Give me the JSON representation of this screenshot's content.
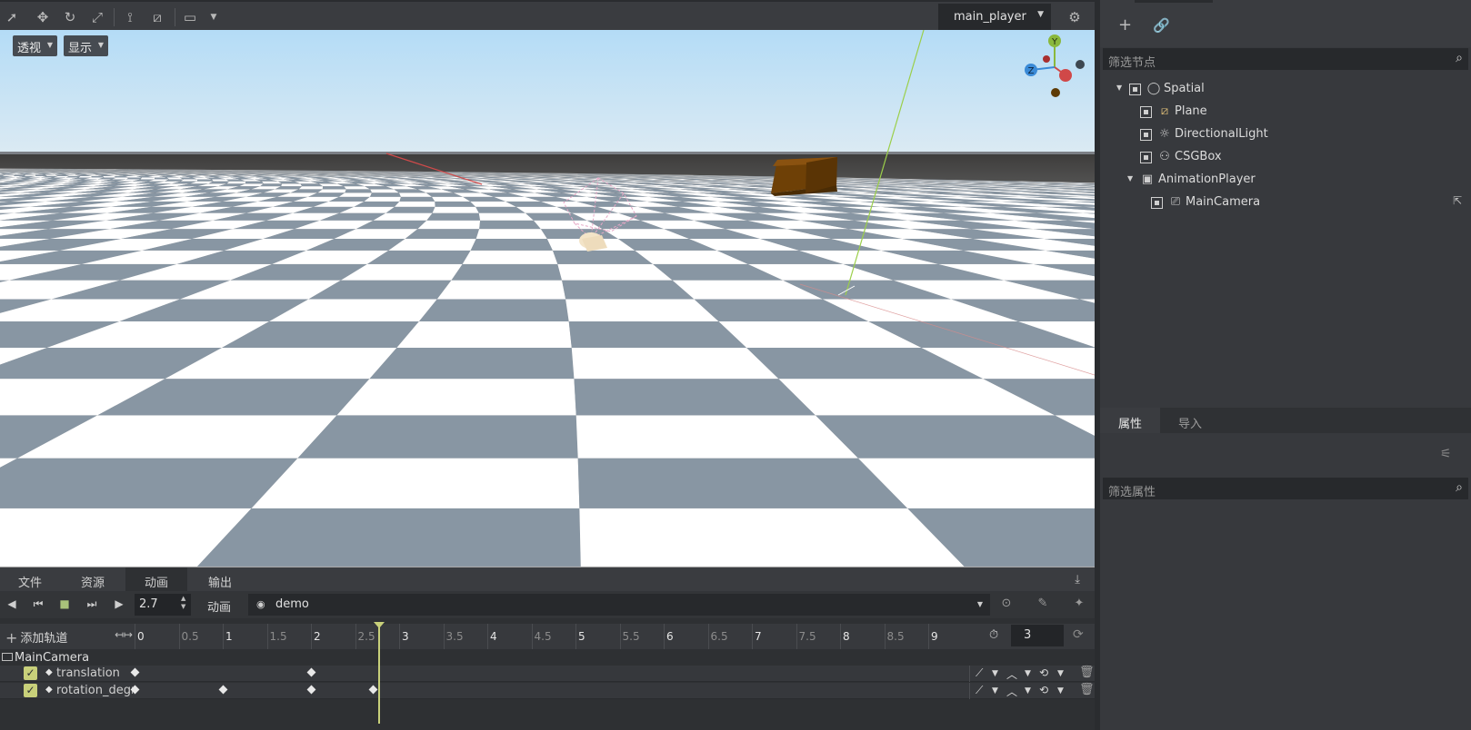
{
  "toolbar": {
    "player_select": "main_player",
    "icons": [
      "select-icon",
      "move-icon",
      "rotate-icon",
      "scale-icon",
      "local-space-icon",
      "snap-icon",
      "view-icon",
      "settings-icon"
    ]
  },
  "viewport": {
    "perspective_btn": "透视",
    "display_btn": "显示",
    "gizmo_labels": {
      "y": "Y",
      "z": "Z"
    },
    "colors": {
      "sky_top": "#b4dcf6",
      "sky_bottom": "#dbeaf3",
      "floor_dark": "#8896a3",
      "floor_light": "#ffffff",
      "box": "#7a4608"
    }
  },
  "bottom_tabs": [
    "文件",
    "资源",
    "动画",
    "输出"
  ],
  "animation": {
    "current_time": "2.7",
    "label": "动画",
    "animation_name": "demo",
    "add_track": "添加轨道",
    "ruler": [
      {
        "label": "0",
        "major": true
      },
      {
        "label": "0.5",
        "major": false
      },
      {
        "label": "1",
        "major": true
      },
      {
        "label": "1.5",
        "major": false
      },
      {
        "label": "2",
        "major": true
      },
      {
        "label": "2.5",
        "major": false
      },
      {
        "label": "3",
        "major": true
      },
      {
        "label": "3.5",
        "major": false
      },
      {
        "label": "4",
        "major": true
      },
      {
        "label": "4.5",
        "major": false
      },
      {
        "label": "5",
        "major": true
      },
      {
        "label": "5.5",
        "major": false
      },
      {
        "label": "6",
        "major": true
      },
      {
        "label": "6.5",
        "major": false
      },
      {
        "label": "7",
        "major": true
      },
      {
        "label": "7.5",
        "major": false
      },
      {
        "label": "8",
        "major": true
      },
      {
        "label": "8.5",
        "major": false
      },
      {
        "label": "9",
        "major": true
      }
    ],
    "length": "3",
    "group": "MainCamera",
    "tracks": [
      {
        "name": "translation",
        "keys": [
          0,
          2
        ]
      },
      {
        "name": "rotation_degrees",
        "keys": [
          0,
          1,
          2,
          2.7
        ]
      }
    ]
  },
  "scene": {
    "filter_placeholder": "筛选节点",
    "nodes": [
      {
        "label": "Spatial",
        "icon": "spatial-icon"
      },
      {
        "label": "Plane",
        "icon": "mesh-icon"
      },
      {
        "label": "DirectionalLight",
        "icon": "light-icon"
      },
      {
        "label": "CSGBox",
        "icon": "csg-icon"
      },
      {
        "label": "AnimationPlayer",
        "icon": "animation-player-icon"
      },
      {
        "label": "MainCamera",
        "icon": "camera-icon"
      }
    ]
  },
  "inspector": {
    "tab_properties": "属性",
    "tab_import": "导入",
    "filter_placeholder": "筛选属性"
  }
}
